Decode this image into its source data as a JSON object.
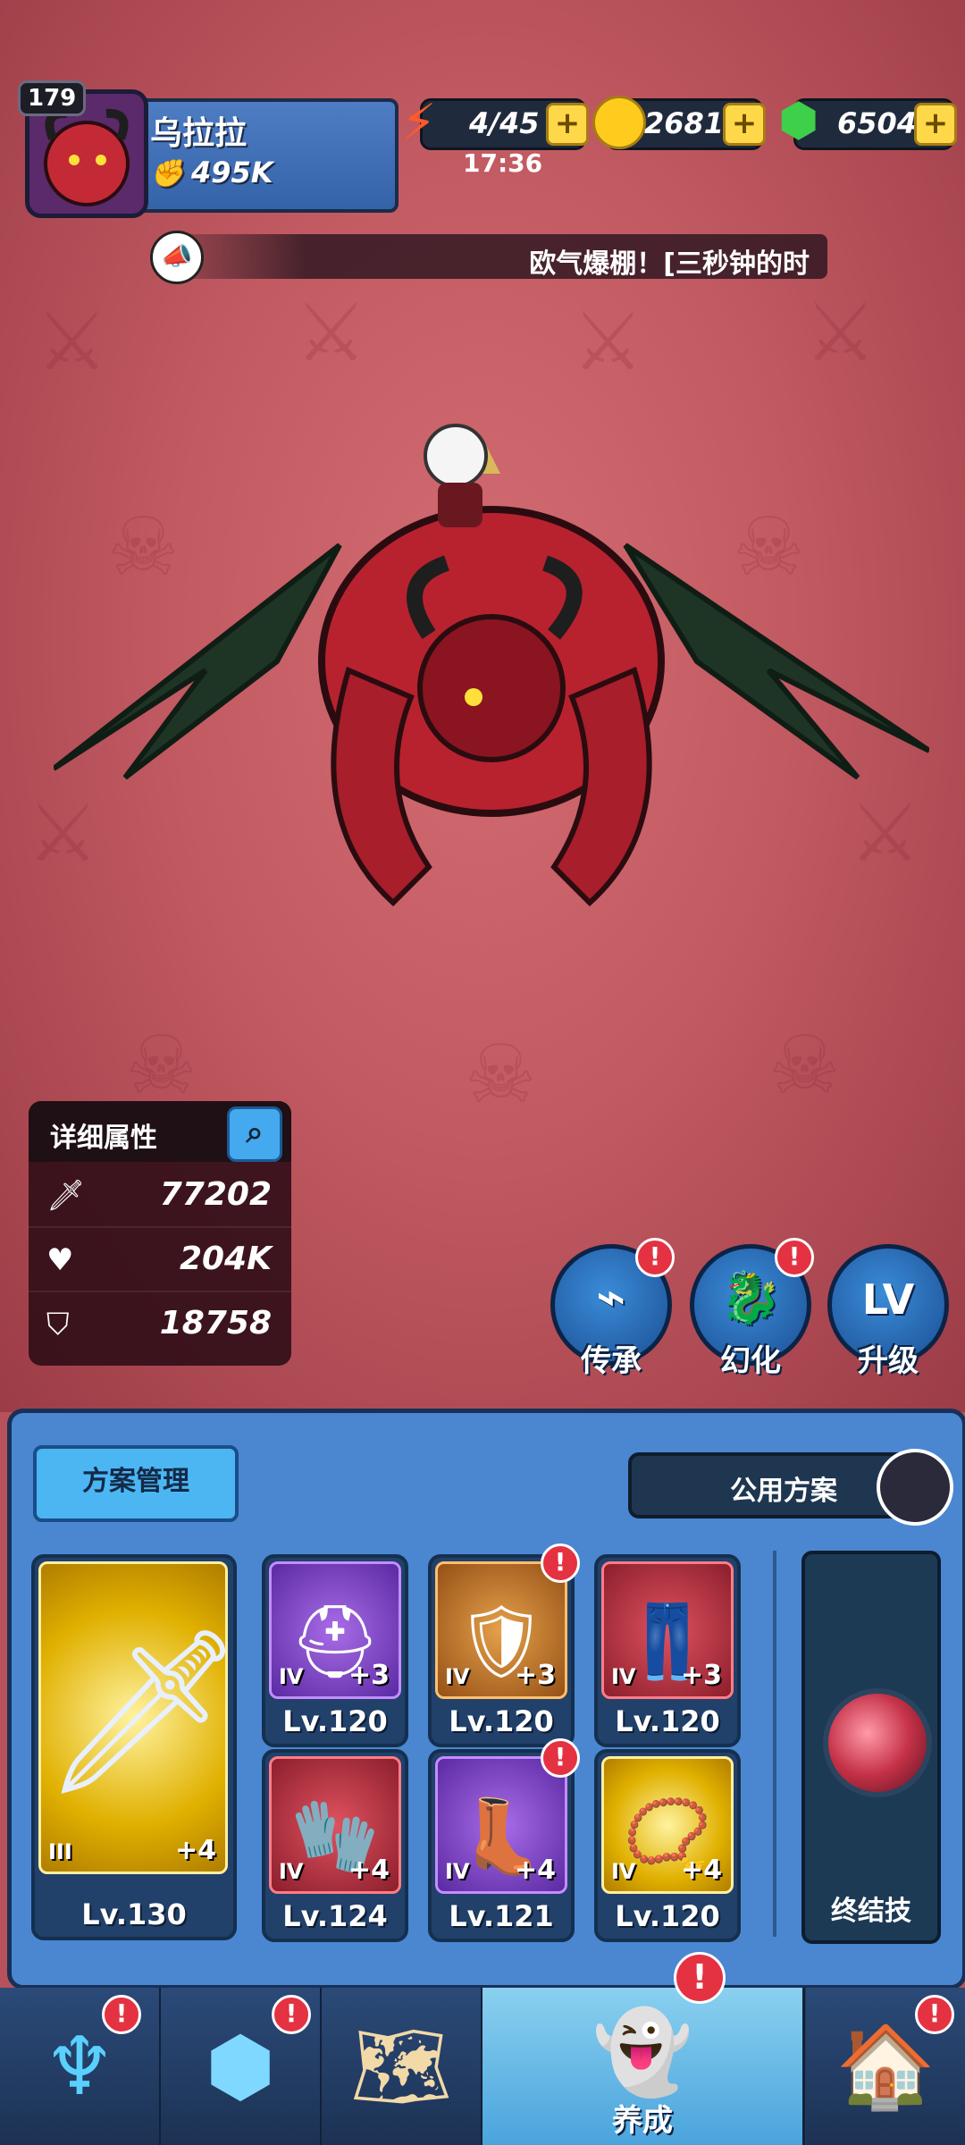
{
  "player": {
    "level": "179",
    "name": "乌拉拉",
    "power": "495K"
  },
  "resources": {
    "energy": "4/45",
    "energy_timer": "17:36",
    "gold": "2681K",
    "gems": "6504"
  },
  "announcement": "欧气爆棚！[三秒钟的时",
  "stats": {
    "title": "详细属性",
    "attack": "77202",
    "hp": "204K",
    "defense": "18758"
  },
  "actions": {
    "inherit": "传承",
    "transform": "幻化",
    "upgrade": "升级",
    "upgrade_glyph": "LV"
  },
  "equipment": {
    "plan_manage": "方案管理",
    "public_plan": "公用方案",
    "weapon": {
      "tier": "III",
      "plus": "+4",
      "level": "Lv.130"
    },
    "slots": [
      {
        "tier": "IV",
        "plus": "+3",
        "level": "Lv.120"
      },
      {
        "tier": "IV",
        "plus": "+3",
        "level": "Lv.120"
      },
      {
        "tier": "IV",
        "plus": "+3",
        "level": "Lv.120"
      },
      {
        "tier": "IV",
        "plus": "+4",
        "level": "Lv.124"
      },
      {
        "tier": "IV",
        "plus": "+4",
        "level": "Lv.121"
      },
      {
        "tier": "IV",
        "plus": "+4",
        "level": "Lv.120"
      }
    ],
    "ultimate": "终结技"
  },
  "nav": {
    "develop": "养成"
  },
  "alert_mark": "!",
  "plus_mark": "+",
  "colors": {
    "bg": "#c25a62",
    "panel": "#4b86d1",
    "alert": "#e43242",
    "accent_gold": "#ffd84a"
  }
}
